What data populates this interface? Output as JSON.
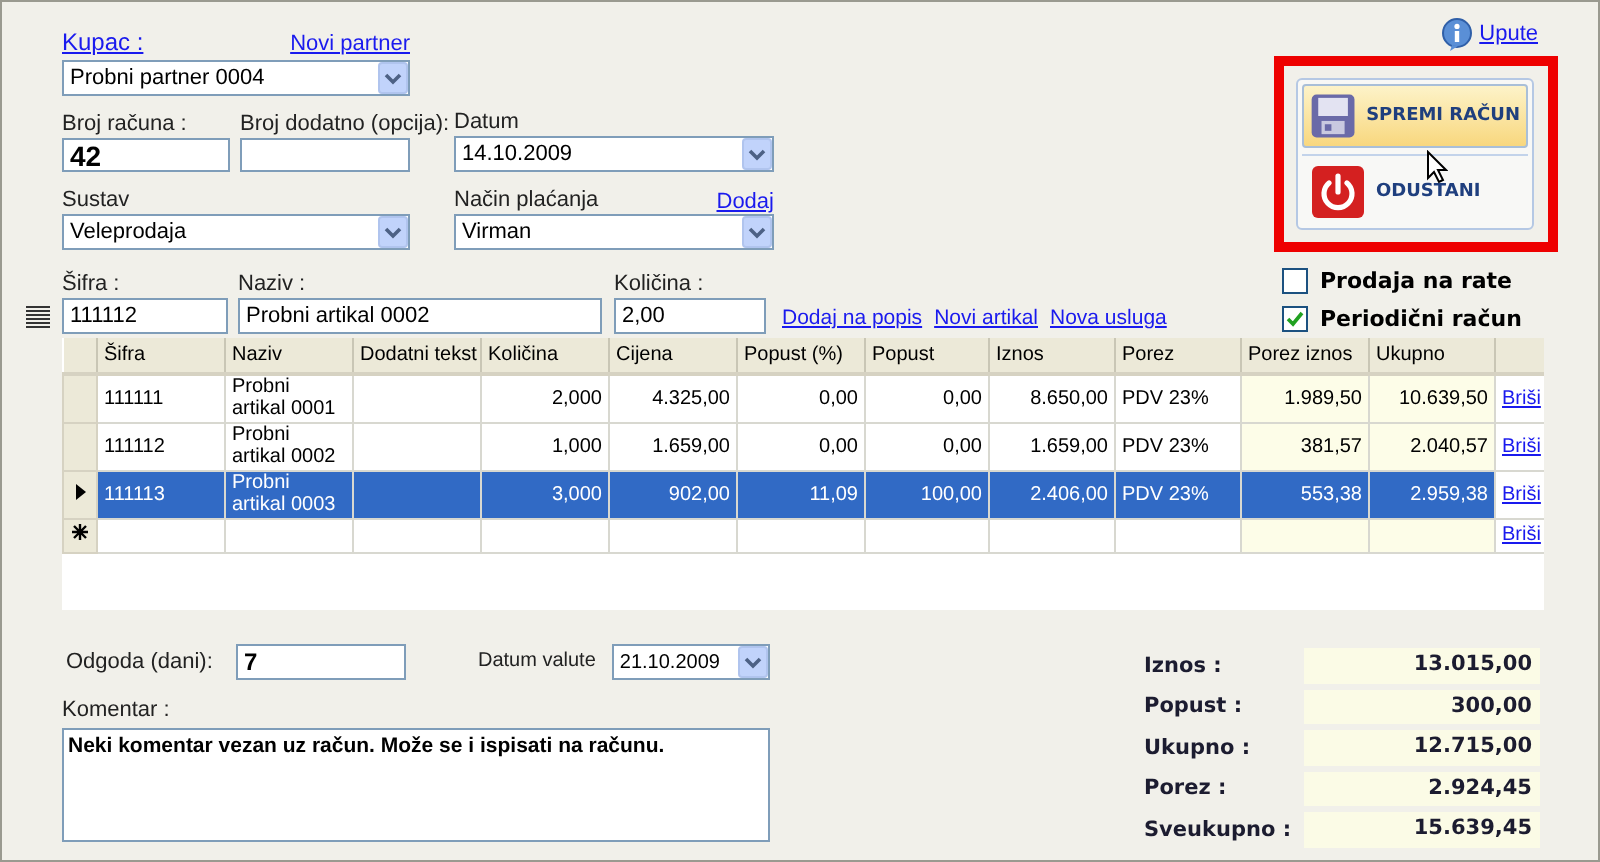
{
  "customer": {
    "label": "Kupac :",
    "new_link": "Novi partner",
    "value": "Probni partner 0004"
  },
  "help_link": "Upute",
  "actions": [
    {
      "kind": "save",
      "label": "SPREMI RAČUN",
      "highlighted": true
    },
    {
      "kind": "cancel",
      "label": "ODUSTANI",
      "highlighted": false
    }
  ],
  "invoice_number": {
    "label": "Broj računa :",
    "value": "42"
  },
  "extra_number": {
    "label": "Broj dodatno (opcija):"
  },
  "date": {
    "label": "Datum",
    "value": "14.10.2009"
  },
  "system": {
    "label": "Sustav",
    "value": "Veleprodaja"
  },
  "payment": {
    "label": "Način plaćanja",
    "add_link": "Dodaj",
    "value": "Virman"
  },
  "options": [
    {
      "label": "Prodaja na rate",
      "checked": false
    },
    {
      "label": "Periodični račun",
      "checked": true
    }
  ],
  "entry": {
    "fields": [
      {
        "label": "Šifra :",
        "value": "111112"
      },
      {
        "label": "Naziv :",
        "value": "Probni artikal 0002"
      },
      {
        "label": "Količina :",
        "value": "2,00"
      }
    ],
    "links": [
      "Dodaj na popis",
      "Novi artikal",
      "Nova usluga"
    ]
  },
  "table": {
    "columns": [
      {
        "label": "Šifra",
        "kind": "text"
      },
      {
        "label": "Naziv",
        "kind": "text"
      },
      {
        "label": "Dodatni tekst",
        "kind": "text"
      },
      {
        "label": "Količina",
        "kind": "number"
      },
      {
        "label": "Cijena",
        "kind": "number"
      },
      {
        "label": "Popust (%)",
        "kind": "number"
      },
      {
        "label": "Popust",
        "kind": "number"
      },
      {
        "label": "Iznos",
        "kind": "number"
      },
      {
        "label": "Porez",
        "kind": "text"
      },
      {
        "label": "Porez iznos",
        "kind": "computed"
      },
      {
        "label": "Ukupno",
        "kind": "computed"
      }
    ],
    "rows": [
      {
        "kind": "item",
        "selected": false,
        "cells": [
          "111111",
          "Probni artikal 0001",
          "",
          "2,000",
          "4.325,00",
          "0,00",
          "0,00",
          "8.650,00",
          "PDV 23%",
          "1.989,50",
          "10.639,50"
        ],
        "action": "Briši"
      },
      {
        "kind": "item",
        "selected": false,
        "cells": [
          "111112",
          "Probni artikal 0002",
          "",
          "1,000",
          "1.659,00",
          "0,00",
          "0,00",
          "1.659,00",
          "PDV 23%",
          "381,57",
          "2.040,57"
        ],
        "action": "Briši"
      },
      {
        "kind": "item",
        "selected": true,
        "cells": [
          "111113",
          "Probni artikal 0003",
          "",
          "3,000",
          "902,00",
          "11,09",
          "100,00",
          "2.406,00",
          "PDV 23%",
          "553,38",
          "2.959,38"
        ],
        "action": "Briši"
      },
      {
        "kind": "new",
        "selected": false,
        "action": "Briši"
      }
    ]
  },
  "delay": {
    "label": "Odgoda (dani):",
    "value": "7"
  },
  "due_date": {
    "label": "Datum valute",
    "value": "21.10.2009"
  },
  "comment": {
    "label": "Komentar :",
    "value": "Neki komentar vezan uz račun. Može se i ispisati na računu."
  },
  "totals": [
    {
      "label": "Iznos :",
      "value": "13.015,00"
    },
    {
      "label": "Popust :",
      "value": "300,00"
    },
    {
      "label": "Ukupno :",
      "value": "12.715,00"
    },
    {
      "label": "Porez :",
      "value": "2.924,45"
    },
    {
      "label": "Sveukupno :",
      "value": "15.639,45"
    }
  ]
}
